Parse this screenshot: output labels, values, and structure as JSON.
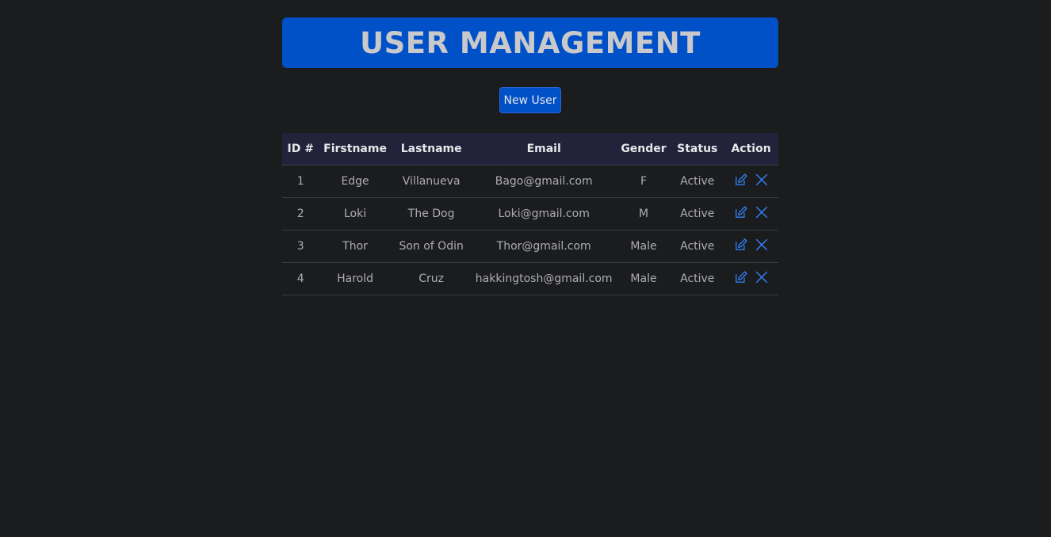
{
  "header": {
    "title": "USER MANAGEMENT"
  },
  "toolbar": {
    "new_user_label": "New User"
  },
  "table": {
    "columns": [
      "ID #",
      "Firstname",
      "Lastname",
      "Email",
      "Gender",
      "Status",
      "Action"
    ],
    "rows": [
      {
        "id": "1",
        "firstname": "Edge",
        "lastname": "Villanueva",
        "email": "Bago@gmail.com",
        "gender": "F",
        "status": "Active"
      },
      {
        "id": "2",
        "firstname": "Loki",
        "lastname": "The Dog",
        "email": "Loki@gmail.com",
        "gender": "M",
        "status": "Active"
      },
      {
        "id": "3",
        "firstname": "Thor",
        "lastname": "Son of Odin",
        "email": "Thor@gmail.com",
        "gender": "Male",
        "status": "Active"
      },
      {
        "id": "4",
        "firstname": "Harold",
        "lastname": "Cruz",
        "email": "hakkingtosh@gmail.com",
        "gender": "Male",
        "status": "Active"
      }
    ]
  },
  "icons": {
    "edit": "edit-icon",
    "delete": "close-icon"
  },
  "colors": {
    "accent": "#0050c8",
    "background": "#1b1c1e",
    "header_row": "#22233a",
    "icon": "#2f7ff2"
  }
}
